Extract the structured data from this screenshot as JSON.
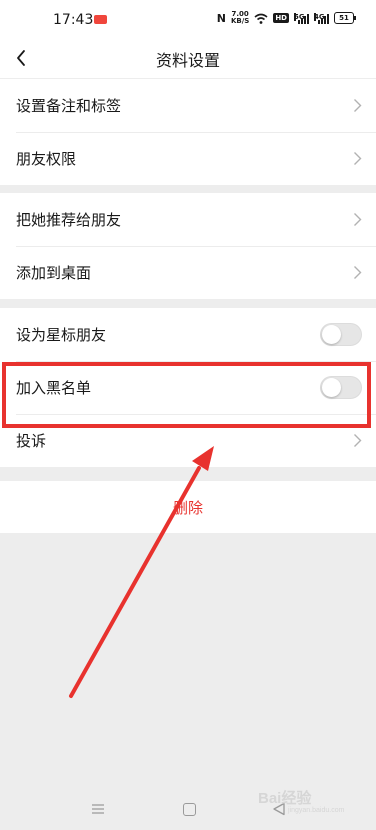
{
  "status_bar": {
    "time": "17:43",
    "nfc_glyph": "N",
    "speed_value": "7.00",
    "speed_unit": "KB/S",
    "hd_badge": "HD",
    "net_1": "5G",
    "net_2": "4G",
    "battery": "51",
    "icons": [
      "app-notification-icon",
      "nfc-icon",
      "wifi-icon",
      "signal-icon",
      "battery-icon"
    ]
  },
  "nav": {
    "title": "资料设置",
    "back_icon": "chevron-left-icon"
  },
  "groups": [
    {
      "items": [
        {
          "label": "设置备注和标签",
          "accessory": "chevron"
        },
        {
          "label": "朋友权限",
          "accessory": "chevron"
        }
      ]
    },
    {
      "items": [
        {
          "label": "把她推荐给朋友",
          "accessory": "chevron"
        },
        {
          "label": "添加到桌面",
          "accessory": "chevron"
        }
      ]
    },
    {
      "items": [
        {
          "label": "设为星标朋友",
          "accessory": "toggle",
          "on": false
        },
        {
          "label": "加入黑名单",
          "accessory": "toggle",
          "on": false
        },
        {
          "label": "投诉",
          "accessory": "chevron"
        }
      ]
    }
  ],
  "delete": {
    "label": "删除"
  },
  "annotation": {
    "color": "#e8322e"
  },
  "colors": {
    "delete_text": "#e8322e",
    "background": "#ededed"
  },
  "watermark": {
    "brand": "Bai经验",
    "url": "jingyan.baidu.com"
  }
}
